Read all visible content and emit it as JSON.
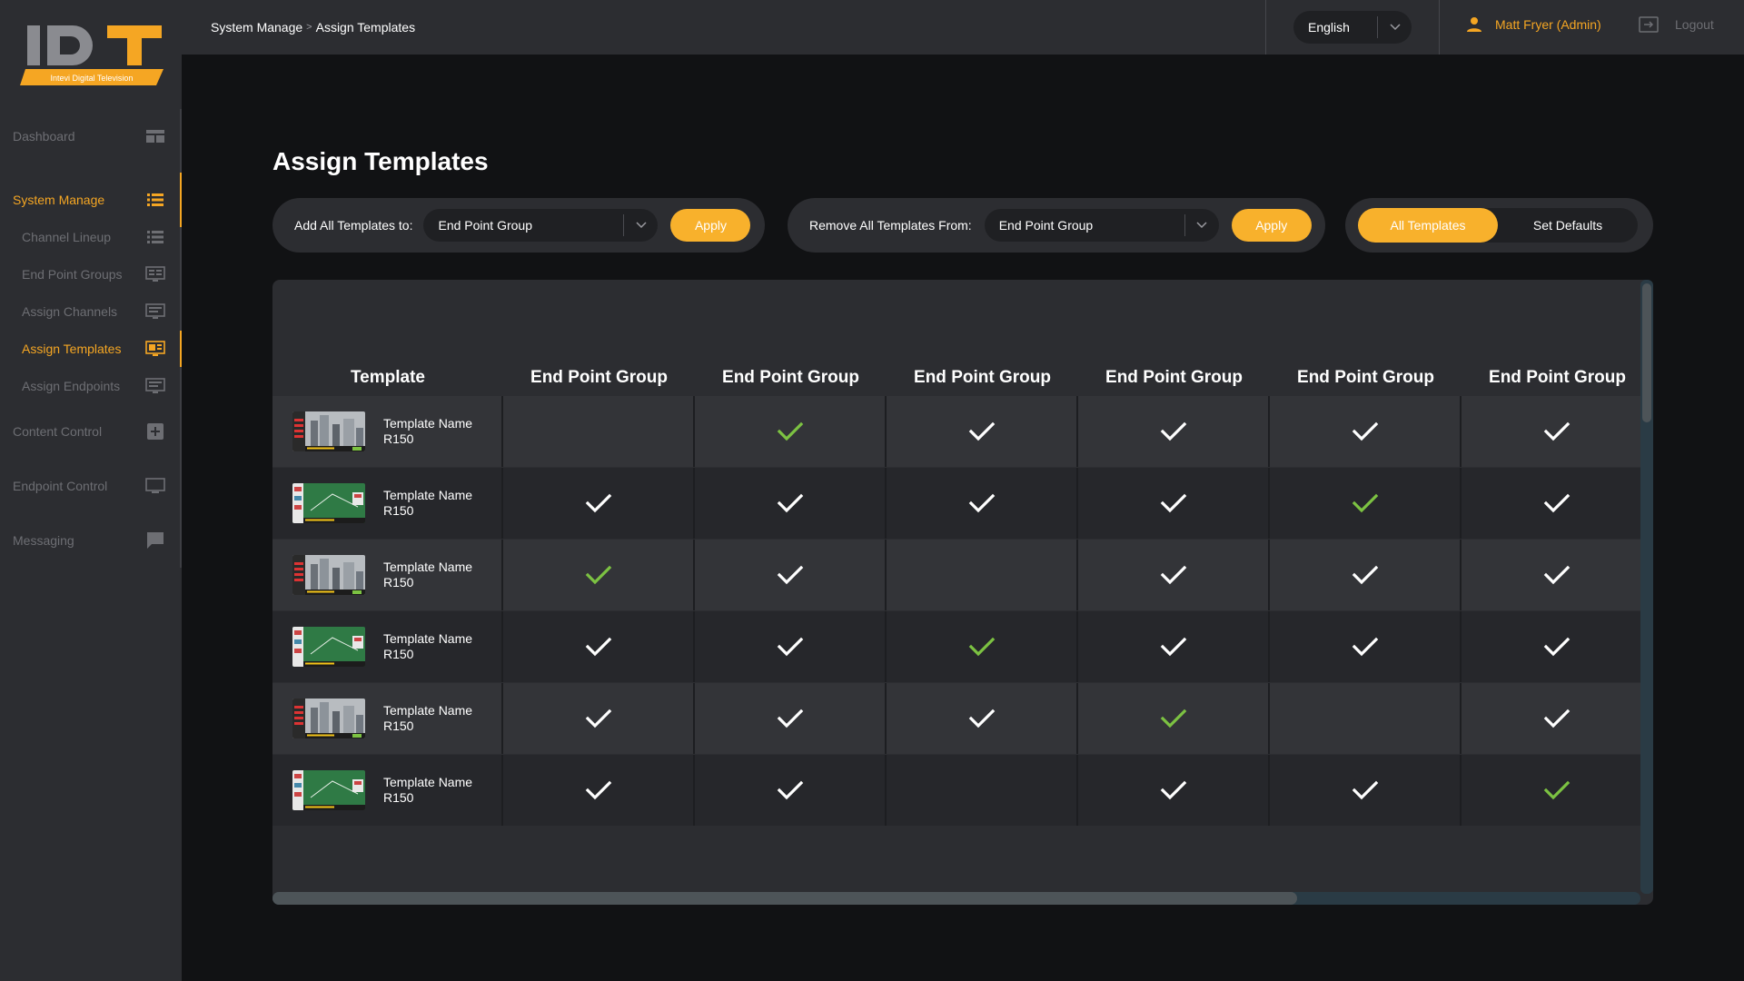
{
  "app": {
    "logo_text": "IDT",
    "logo_subtitle": "Intevi Digital Television"
  },
  "colors": {
    "accent": "#f5a623",
    "button": "#f8b12c",
    "check_white": "#ffffff",
    "check_green": "#7cc242",
    "sidebar_bg": "#2c2d31",
    "page_bg": "#111214"
  },
  "sidebar": {
    "items": [
      {
        "label": "Dashboard",
        "icon": "dashboard-icon"
      },
      {
        "label": "System Manage",
        "icon": "list-icon",
        "active": true
      },
      {
        "label": "Channel Lineup",
        "icon": "list-icon"
      },
      {
        "label": "End Point Groups",
        "icon": "monitor-group-icon"
      },
      {
        "label": "Assign Channels",
        "icon": "monitor-icon"
      },
      {
        "label": "Assign Templates",
        "icon": "template-icon",
        "active": true
      },
      {
        "label": "Assign Endpoints",
        "icon": "monitor-icon"
      },
      {
        "label": "Content Control",
        "icon": "add-box-icon"
      },
      {
        "label": "Endpoint Control",
        "icon": "display-icon"
      },
      {
        "label": "Messaging",
        "icon": "chat-icon"
      }
    ]
  },
  "header": {
    "breadcrumb": [
      "System Manage",
      "Assign Templates"
    ],
    "language": "English",
    "user": "Matt Fryer (Admin)",
    "logout": "Logout"
  },
  "main": {
    "title": "Assign Templates",
    "add_panel": {
      "label": "Add All Templates to:",
      "value": "End Point Group",
      "button": "Apply"
    },
    "remove_panel": {
      "label": "Remove All Templates From:",
      "value": "End Point Group",
      "button": "Apply"
    },
    "filter": {
      "options": [
        "All Templates",
        "Set Defaults"
      ],
      "selected": "All Templates"
    }
  },
  "table": {
    "columns": [
      "Template",
      "End Point Group",
      "End Point Group",
      "End Point Group",
      "End Point Group",
      "End Point Group",
      "End Point Group"
    ],
    "rows": [
      {
        "name": "Template Name",
        "code": "R150",
        "thumb": "city",
        "checks": [
          "",
          "green",
          "white",
          "white",
          "white",
          "white"
        ]
      },
      {
        "name": "Template Name",
        "code": "R150",
        "thumb": "pitch",
        "checks": [
          "white",
          "white",
          "white",
          "white",
          "green",
          "white"
        ]
      },
      {
        "name": "Template Name",
        "code": "R150",
        "thumb": "city",
        "checks": [
          "green",
          "white",
          "",
          "white",
          "white",
          "white"
        ]
      },
      {
        "name": "Template Name",
        "code": "R150",
        "thumb": "pitch",
        "checks": [
          "white",
          "white",
          "green",
          "white",
          "white",
          "white"
        ]
      },
      {
        "name": "Template Name",
        "code": "R150",
        "thumb": "city",
        "checks": [
          "white",
          "white",
          "white",
          "green",
          "",
          "white"
        ]
      },
      {
        "name": "Template Name",
        "code": "R150",
        "thumb": "pitch",
        "checks": [
          "white",
          "white",
          "",
          "white",
          "white",
          "green"
        ]
      }
    ]
  }
}
